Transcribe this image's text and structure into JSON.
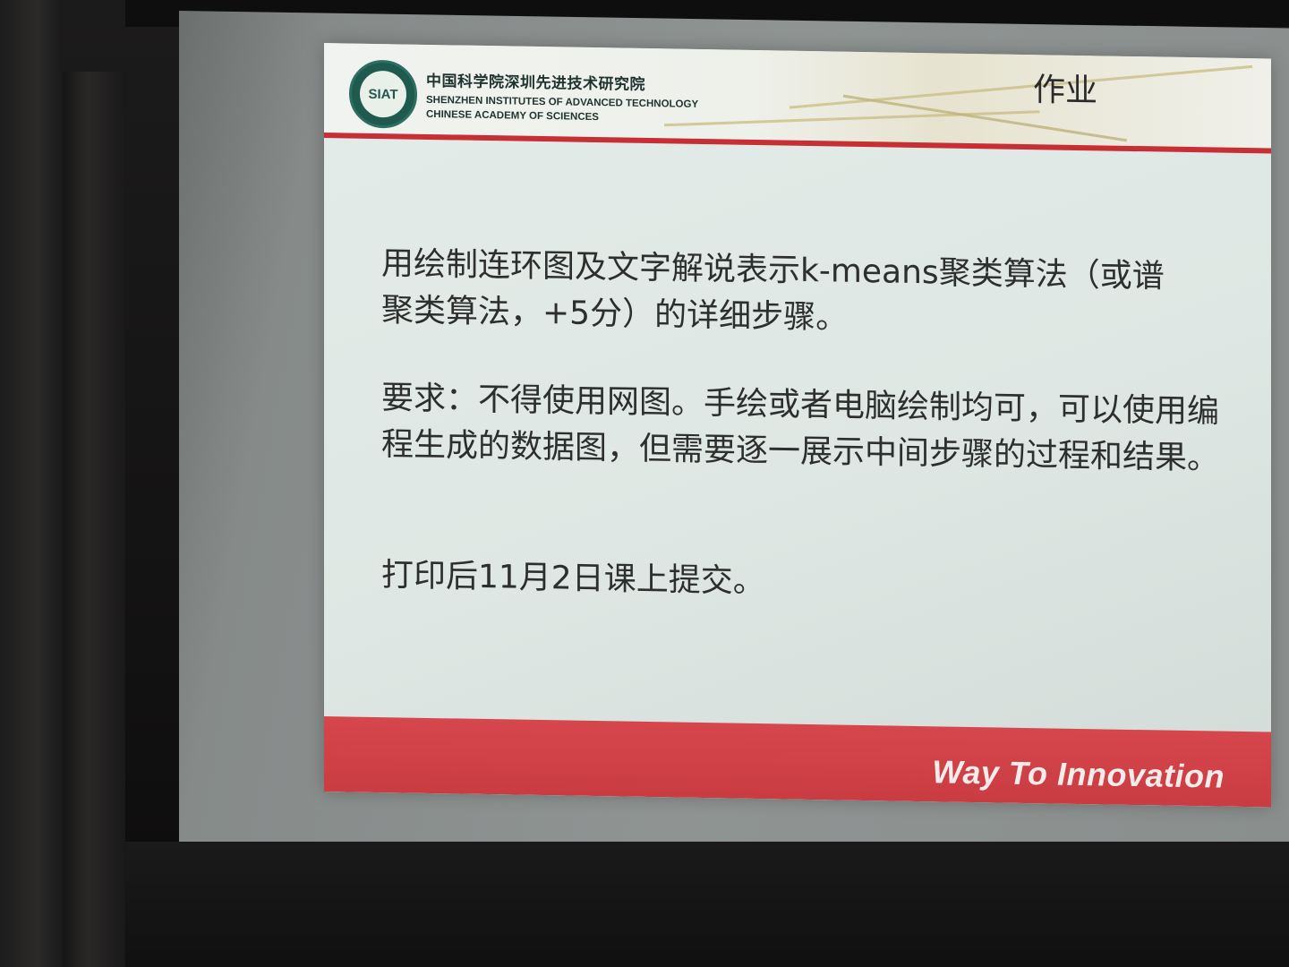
{
  "slide": {
    "org_name_cn": "中国科学院深圳先进技术研究院",
    "org_name_en_line1": "SHENZHEN INSTITUTES OF ADVANCED TECHNOLOGY",
    "org_name_en_line2": "CHINESE ACADEMY OF SCIENCES",
    "logo_text": "SIAT",
    "title": "作业",
    "paragraphs": [
      "用绘制连环图及文字解说表示k-means聚类算法（或谱聚类算法，+5分）的详细步骤。",
      "要求：不得使用网图。手绘或者电脑绘制均可，可以使用编程生成的数据图，但需要逐一展示中间步骤的过程和结果。",
      "打印后11月2日课上提交。"
    ],
    "footer_slogan": "Way To Innovation",
    "colors": {
      "accent_red": "#c62f34",
      "slide_background": "#e0e8e5",
      "logo_green": "#1f5a4f"
    }
  }
}
